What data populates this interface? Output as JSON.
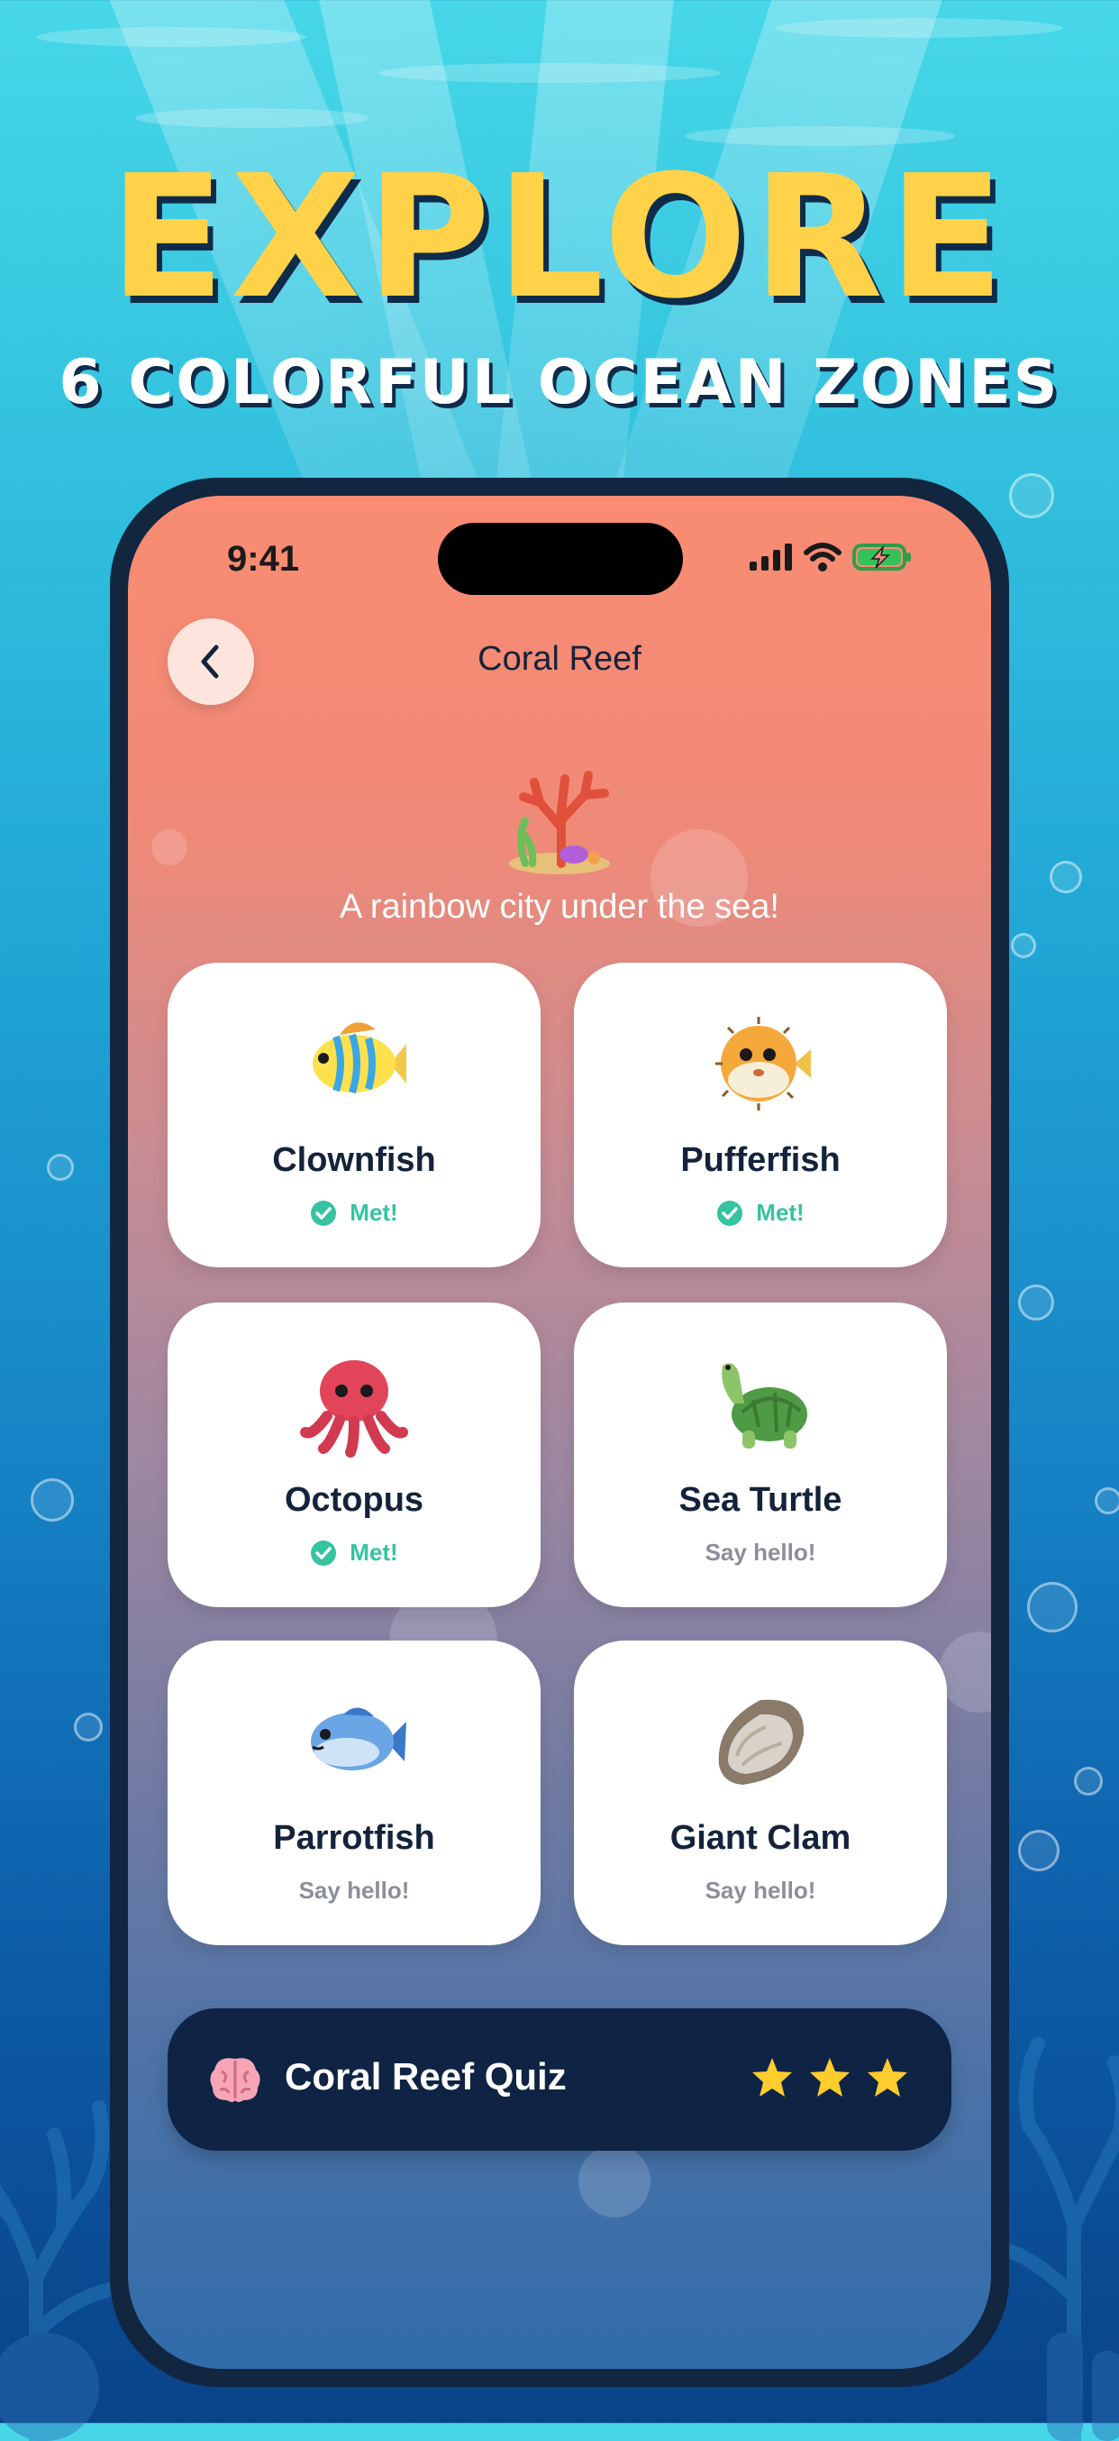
{
  "promo": {
    "headline": "EXPLORE",
    "subheadline": "6 COLORFUL OCEAN ZONES"
  },
  "status_bar": {
    "time": "9:41"
  },
  "nav": {
    "title": "Coral Reef"
  },
  "zone": {
    "icon": "coral-icon",
    "tagline": "A rainbow city under the sea!"
  },
  "animals": [
    {
      "name": "Clownfish",
      "status": "Met!",
      "met": true,
      "icon": "tropical-fish-icon"
    },
    {
      "name": "Pufferfish",
      "status": "Met!",
      "met": true,
      "icon": "pufferfish-icon"
    },
    {
      "name": "Octopus",
      "status": "Met!",
      "met": true,
      "icon": "octopus-icon"
    },
    {
      "name": "Sea Turtle",
      "status": "Say hello!",
      "met": false,
      "icon": "turtle-icon"
    },
    {
      "name": "Parrotfish",
      "status": "Say hello!",
      "met": false,
      "icon": "fish-icon"
    },
    {
      "name": "Giant Clam",
      "status": "Say hello!",
      "met": false,
      "icon": "oyster-icon"
    }
  ],
  "quiz": {
    "title": "Coral Reef Quiz",
    "icon": "brain-icon",
    "stars": 3,
    "stars_max": 3
  },
  "colors": {
    "headline": "#ffd24a",
    "met_green": "#35c3a0",
    "hello_gray": "#8a8f98",
    "quiz_bar": "#0f2444",
    "star": "#ffcc2e"
  }
}
